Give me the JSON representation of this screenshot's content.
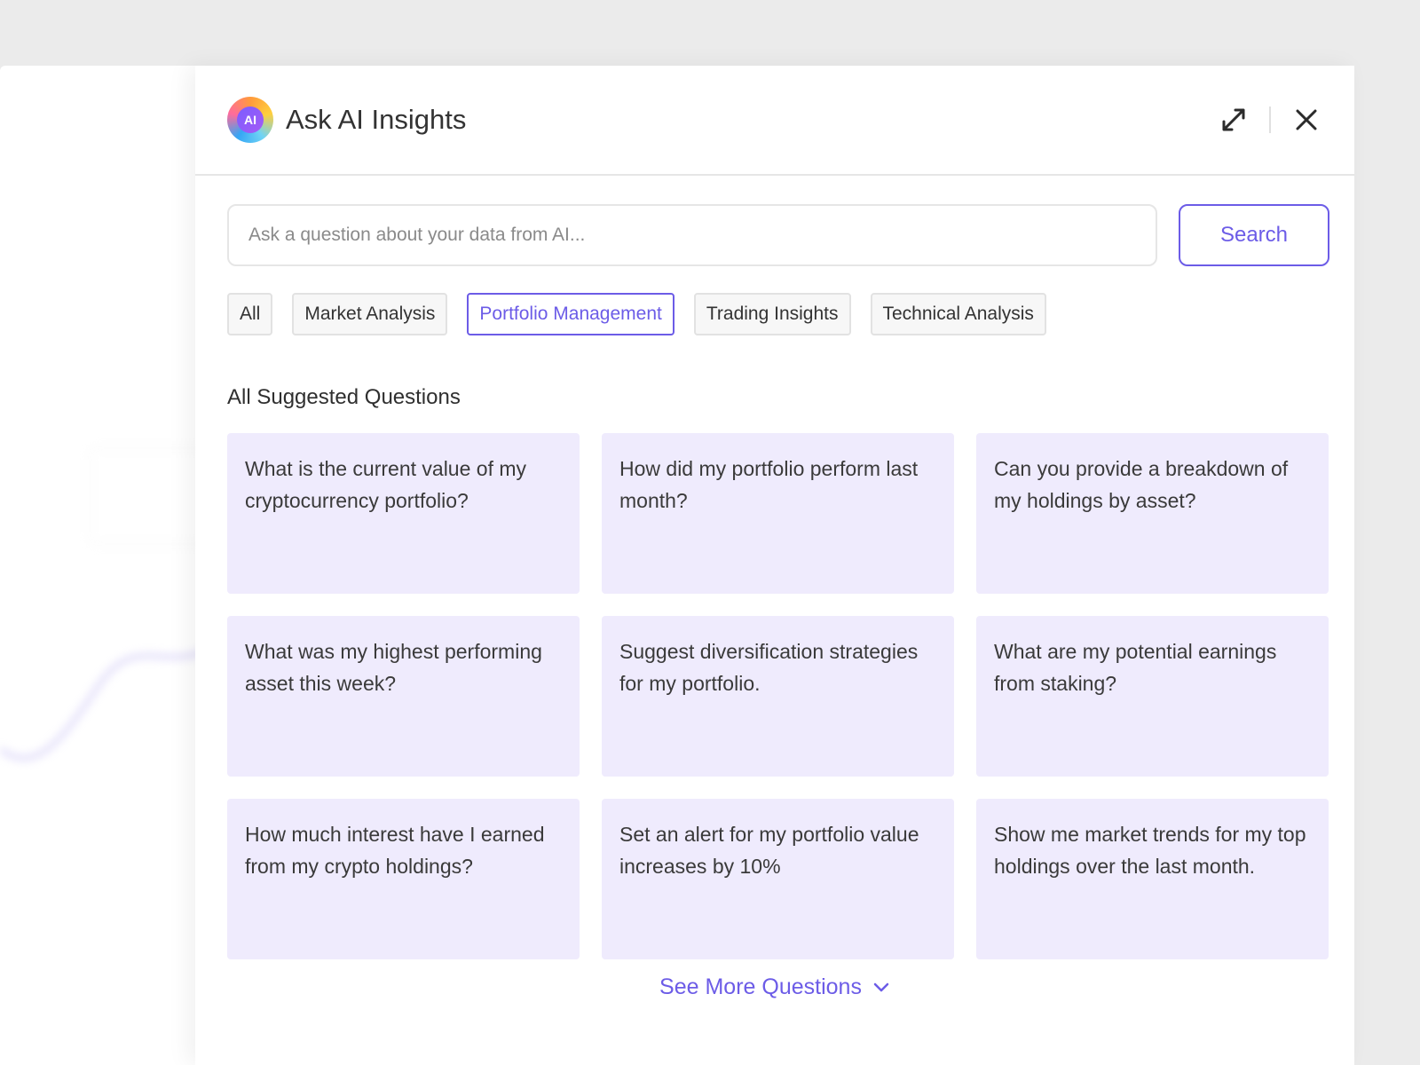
{
  "panel": {
    "logo_text": "AI",
    "title": "Ask AI Insights"
  },
  "search": {
    "placeholder": "Ask a question about your data from AI...",
    "button_label": "Search"
  },
  "filters": [
    {
      "label": "All",
      "active": false
    },
    {
      "label": "Market Analysis",
      "active": false
    },
    {
      "label": "Portfolio Management",
      "active": true
    },
    {
      "label": "Trading Insights",
      "active": false
    },
    {
      "label": "Technical Analysis",
      "active": false
    }
  ],
  "section_title": "All Suggested Questions",
  "questions": [
    "What is the current value of my cryptocurrency portfolio?",
    "How did my portfolio perform last month?",
    "Can you provide a breakdown of my holdings by asset?",
    "What was my highest performing asset this week?",
    "Suggest diversification strategies for my portfolio.",
    "What are my potential earnings from staking?",
    "How much interest have I earned from my crypto holdings?",
    "Set an alert for my portfolio value increases by 10%",
    "Show me market trends for my top holdings over the last month."
  ],
  "see_more_label": "See More Questions",
  "colors": {
    "accent": "#6c5ce7",
    "card_bg": "#efebfd",
    "backdrop": "#ebebeb"
  },
  "icons": {
    "expand": "expand-icon",
    "close": "close-icon",
    "chevron": "chevron-down-icon"
  }
}
